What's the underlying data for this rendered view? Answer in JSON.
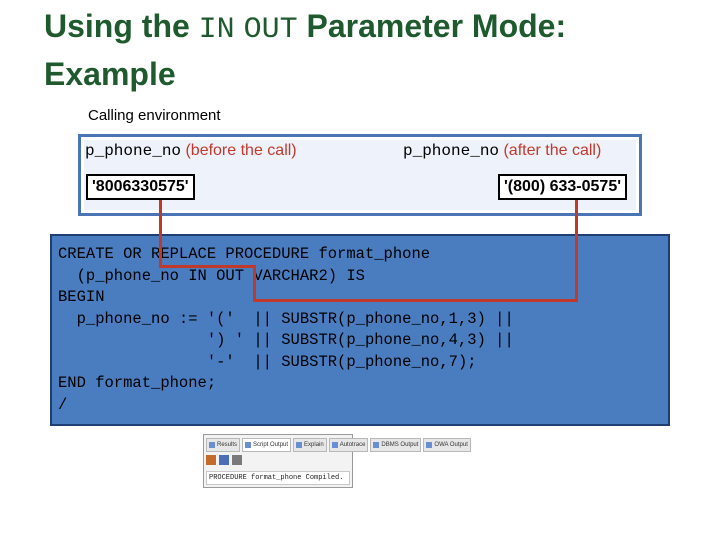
{
  "title": {
    "part1": "Using the ",
    "kw1": "IN",
    "kw2": "OUT",
    "part2": " Parameter Mode:",
    "line2": "Example"
  },
  "environment": {
    "label": "Calling environment",
    "before_param": "p_phone_no",
    "before_note": " (before the call)",
    "after_param": "p_phone_no",
    "after_note": " (after the call)",
    "before_value": "'8006330575'",
    "after_value": "'(800) 633-0575'"
  },
  "code_lines": [
    "CREATE OR REPLACE PROCEDURE format_phone",
    "  (p_phone_no IN OUT VARCHAR2) IS",
    "BEGIN",
    "  p_phone_no := '('  || SUBSTR(p_phone_no,1,3) ||",
    "                ') ' || SUBSTR(p_phone_no,4,3) ||",
    "                '-'  || SUBSTR(p_phone_no,7);",
    "END format_phone;",
    "/"
  ],
  "output_panel": {
    "tabs": [
      "Results",
      "Script Output",
      "Explain",
      "Autotrace",
      "DBMS Output",
      "OWA Output"
    ],
    "active_tab": "Script Output",
    "message": "PROCEDURE format_phone Compiled."
  },
  "colors": {
    "title": "#1f5a2e",
    "accent_red": "#c0392b",
    "code_bg": "#4a7cc0",
    "env_border": "#4a74b4"
  }
}
